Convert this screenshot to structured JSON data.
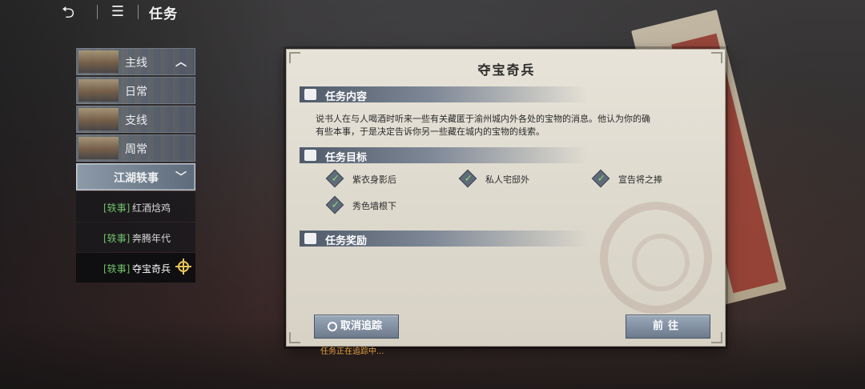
{
  "topbar": {
    "back_icon": "back-arrow-icon",
    "menu_icon": "menu-icon",
    "title": "任务"
  },
  "nav": {
    "categories": [
      {
        "label": "主线",
        "chevron": "chevron-up-icon"
      },
      {
        "label": "日常"
      },
      {
        "label": "支线"
      },
      {
        "label": "周常"
      },
      {
        "label": "江湖轶事",
        "chevron": "chevron-down-icon",
        "active": true
      }
    ],
    "subitems": [
      {
        "tag": "[轶事]",
        "label": "红酒焓鸡"
      },
      {
        "tag": "[轶事]",
        "label": "奔腾年代"
      },
      {
        "tag": "[轶事]",
        "label": "夺宝奇兵",
        "selected": true,
        "tracked_icon": "crosshair-icon"
      }
    ]
  },
  "panel": {
    "title": "夺宝奇兵",
    "content_header": "任务内容",
    "content_text_line1": "说书人在与人喝酒时听来一些有关藏匿于渝州城内外各处的宝物的消息。他认为你的确",
    "content_text_line2": "有些本事，于是决定告诉你另一些藏在城内的宝物的线索。",
    "goals_header": "任务目标",
    "goals": [
      "紫衣身影后",
      "私人宅邸外",
      "宣告将之捧",
      "秀色墙根下"
    ],
    "rewards_header": "任务奖励",
    "cancel_button": "取消追踪",
    "go_button": "前往",
    "tracking_status": "任务正在追踪中..."
  },
  "colors": {
    "accent_green": "#6fbf6a",
    "track_yellow": "#e8c45a",
    "status_orange": "#e8a040",
    "panel_bg": "#e7e3d8"
  }
}
